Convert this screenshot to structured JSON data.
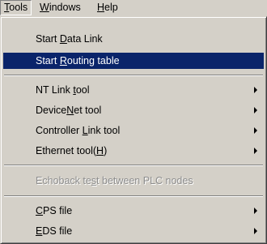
{
  "menubar": {
    "items": [
      {
        "pre": "",
        "key": "T",
        "post": "ools"
      },
      {
        "pre": "",
        "key": "W",
        "post": "indows"
      },
      {
        "pre": "",
        "key": "H",
        "post": "elp"
      }
    ]
  },
  "menu": {
    "items": [
      {
        "pre": "Start ",
        "key": "D",
        "post": "ata Link"
      },
      {
        "pre": "Start ",
        "key": "R",
        "post": "outing table"
      },
      {
        "pre": "NT Link ",
        "key": "t",
        "post": "ool"
      },
      {
        "pre": "Device",
        "key": "N",
        "post": "et tool"
      },
      {
        "pre": "Controller ",
        "key": "L",
        "post": "ink tool"
      },
      {
        "pre": "Ethernet tool(",
        "key": "H",
        "post": ")"
      },
      {
        "pre": "Echoback te",
        "key": "s",
        "post": "t between PLC nodes"
      },
      {
        "pre": "",
        "key": "C",
        "post": "PS file"
      },
      {
        "pre": "",
        "key": "E",
        "post": "DS file"
      }
    ]
  },
  "colors": {
    "menu_background": "#d4d0c8",
    "highlight": "#0a246a",
    "disabled_text": "#8c8c8c"
  }
}
